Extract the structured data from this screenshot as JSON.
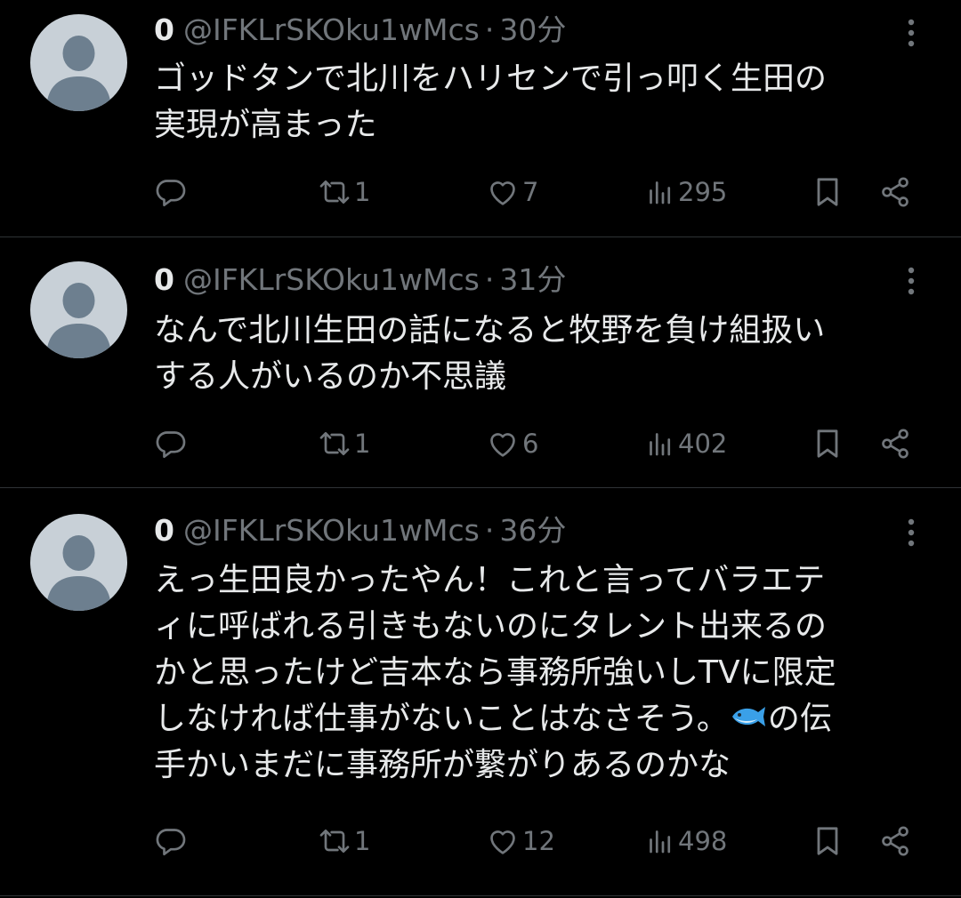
{
  "colors": {
    "background": "#000000",
    "text": "#e7e9ea",
    "muted": "#71767b",
    "divider": "#2f3336",
    "avatar_bg": "#c8d0d7",
    "avatar_fg": "#6d7f8f"
  },
  "icons": {
    "reply": "reply-icon",
    "retweet": "retweet-icon",
    "like": "like-icon",
    "views": "views-icon",
    "bookmark": "bookmark-icon",
    "share": "share-icon",
    "more": "more-icon",
    "inline_emoji": "fish-emoji"
  },
  "posts": [
    {
      "display_name": "0",
      "handle": "@IFKLrSKOku1wMcs",
      "separator": "·",
      "time": "30分",
      "text_lines": [
        "ゴッドタンで北川をハリセンで引っ叩く生田の",
        "実現が高まった"
      ],
      "retweets": "1",
      "likes": "7",
      "views": "295"
    },
    {
      "display_name": "0",
      "handle": "@IFKLrSKOku1wMcs",
      "separator": "·",
      "time": "31分",
      "text_lines": [
        "なんで北川生田の話になると牧野を負け組扱い",
        "する人がいるのか不思議"
      ],
      "retweets": "1",
      "likes": "6",
      "views": "402"
    },
    {
      "display_name": "0",
      "handle": "@IFKLrSKOku1wMcs",
      "separator": "·",
      "time": "36分",
      "text_lines": [
        "えっ生田良かったやん！これと言ってバラエテ",
        "ィに呼ばれる引きもないのにタレント出来るの",
        "かと思ったけど吉本なら事務所強いしTVに限定",
        "しなければ仕事がないことはなさそう。",
        "手かいまだに事務所が繋がりあるのかな"
      ],
      "text_line4_after_emoji": "の伝",
      "retweets": "1",
      "likes": "12",
      "views": "498"
    }
  ]
}
